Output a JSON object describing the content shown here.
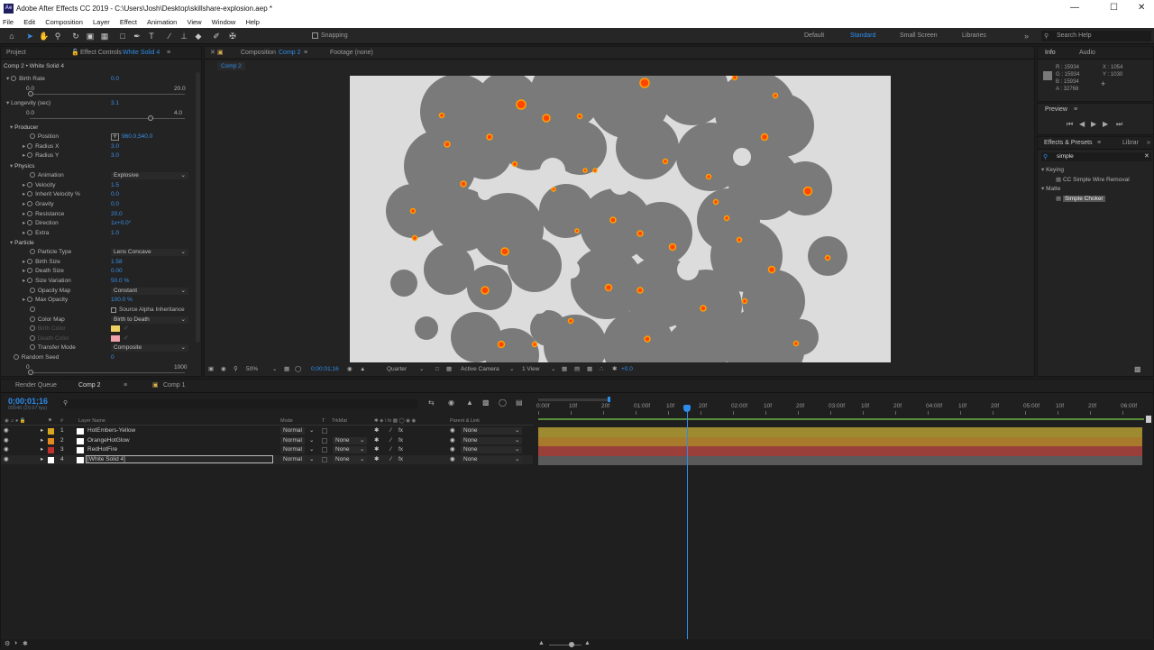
{
  "window": {
    "title": "Adobe After Effects CC 2019 - C:\\Users\\Josh\\Desktop\\skillshare-explosion.aep *",
    "logo": "Ae"
  },
  "menu": [
    "File",
    "Edit",
    "Composition",
    "Layer",
    "Effect",
    "Animation",
    "View",
    "Window",
    "Help"
  ],
  "toolbar": {
    "snapping": "Snapping",
    "workspaces": [
      "Default",
      "Standard",
      "Small Screen",
      "Libraries"
    ],
    "active_workspace": "Standard",
    "search_placeholder": "Search Help"
  },
  "left_panel": {
    "tabs": {
      "project": "Project",
      "effect_controls": "Effect Controls",
      "layer": "White Solid 4"
    },
    "header": "Comp 2 • White Solid 4",
    "rows": [
      {
        "label": "Birth Rate",
        "value": "0.0"
      },
      {
        "label": "0.0",
        "value": "20.0"
      },
      {
        "label": "Longevity (sec)",
        "value": "3.1"
      },
      {
        "label": "0.0",
        "value": "4.0"
      },
      {
        "label": "Producer"
      },
      {
        "label": "Position",
        "value": "960.0,540.0"
      },
      {
        "label": "Radius X",
        "value": "3.0"
      },
      {
        "label": "Radius Y",
        "value": "3.0"
      },
      {
        "label": "Physics"
      },
      {
        "label": "Animation",
        "select": "Explosive"
      },
      {
        "label": "Velocity",
        "value": "1.5"
      },
      {
        "label": "Inherit Velocity %",
        "value": "0.0"
      },
      {
        "label": "Gravity",
        "value": "0.0"
      },
      {
        "label": "Resistance",
        "value": "20.0"
      },
      {
        "label": "Direction",
        "value": "1x+0.0°"
      },
      {
        "label": "Extra",
        "value": "1.0"
      },
      {
        "label": "Particle"
      },
      {
        "label": "Particle Type",
        "select": "Lens Concave"
      },
      {
        "label": "Birth Size",
        "value": "1.58"
      },
      {
        "label": "Death Size",
        "value": "0.00"
      },
      {
        "label": "Size Variation",
        "value": "50.0 %"
      },
      {
        "label": "Opacity Map",
        "select": "Constant"
      },
      {
        "label": "Max Opacity",
        "value": "100.0 %"
      },
      {
        "label": "Source Alpha Inheritance"
      },
      {
        "label": "Color Map",
        "select": "Birth to Death"
      },
      {
        "label": "Birth Color"
      },
      {
        "label": "Death Color"
      },
      {
        "label": "Transfer Mode",
        "select": "Composite"
      },
      {
        "label": "Random Seed",
        "value": "0"
      },
      {
        "label": "0",
        "value": "1000"
      }
    ],
    "birth_rate_fraction": 0.0,
    "longevity_fraction": 0.775
  },
  "comp_panel": {
    "tab": "Composition",
    "comp_name": "Comp 2",
    "footage": "Footage (none)",
    "comp_tab": "Comp 2",
    "zoom": "50%",
    "timecode": "0;00;01;16",
    "resolution": "Quarter",
    "camera": "Active Camera",
    "views": "1 View",
    "exposure": "+0.0"
  },
  "info_panel": {
    "tabs": [
      "Info",
      "Audio"
    ],
    "r": "R : 15934",
    "g": "G : 15934",
    "b": "B : 15934",
    "a": "A : 32768",
    "x": "X : 1054",
    "y": "Y : 1030"
  },
  "preview": {
    "title": "Preview"
  },
  "effects_presets": {
    "title": "Effects & Presets",
    "libraries": "Librar",
    "search": "simple",
    "groups": [
      {
        "name": "Keying",
        "item": "CC Simple Wire Removal"
      },
      {
        "name": "Matte",
        "item": "Simple Choker"
      }
    ]
  },
  "timeline": {
    "tabs": [
      "Render Queue",
      "Comp 2",
      "Comp 1"
    ],
    "timecode": "0;00;01;16",
    "fps": "00046 (29.97 fps)",
    "columns": {
      "layer_name": "Layer Name",
      "mode": "Mode",
      "t": "T",
      "trkmat": "TrkMat",
      "parent": "Parent & Link"
    },
    "layers": [
      {
        "num": "1",
        "name": "HotEmbers-Yellow",
        "mode": "Normal",
        "trkmat": "",
        "parent": "None",
        "color": "#d8a71e",
        "bar": "#9e8a30"
      },
      {
        "num": "2",
        "name": "OrangeHotGlow",
        "mode": "Normal",
        "trkmat": "None",
        "parent": "None",
        "color": "#e58a1f",
        "bar": "#a87a2c"
      },
      {
        "num": "3",
        "name": "RedHotFire",
        "mode": "Normal",
        "trkmat": "None",
        "parent": "None",
        "color": "#c0302c",
        "bar": "#9a3f3a"
      },
      {
        "num": "4",
        "name": "[White Solid 4]",
        "mode": "Normal",
        "trkmat": "None",
        "parent": "None",
        "color": "#ffffff",
        "bar": "#5a5a5a"
      }
    ],
    "ruler": [
      "0:00f",
      "10f",
      "20f",
      "01:00f",
      "10f",
      "20f",
      "02:00f",
      "10f",
      "20f",
      "03:00f",
      "10f",
      "20f",
      "04:00f",
      "10f",
      "20f",
      "05:00f",
      "10f",
      "20f",
      "06:00f"
    ],
    "playhead_fraction": 0.245
  }
}
